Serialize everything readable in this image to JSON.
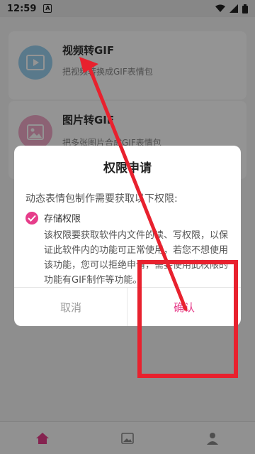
{
  "status_bar": {
    "time": "12:59",
    "notification_glyph": "A"
  },
  "cards": [
    {
      "title": "视频转GIF",
      "subtitle": "把视频转换成GIF表情包",
      "icon": "video-icon"
    },
    {
      "title": "图片转GIF",
      "subtitle": "把多张图片合成GIF表情包",
      "icon": "image-icon"
    }
  ],
  "dialog": {
    "title": "权限申请",
    "description": "动态表情包制作需要获取以下权限:",
    "permission_name": "存储权限",
    "permission_body": "该权限要获取软件内文件的读、写权限，以保证此软件内的功能可正常使用，若您不想使用该功能，您可以拒绝申请，需要使用此权限的功能有GIF制作等功能。",
    "cancel_label": "取消",
    "confirm_label": "确认"
  },
  "colors": {
    "accent": "#e63d8a",
    "annotation": "#e8212e"
  }
}
